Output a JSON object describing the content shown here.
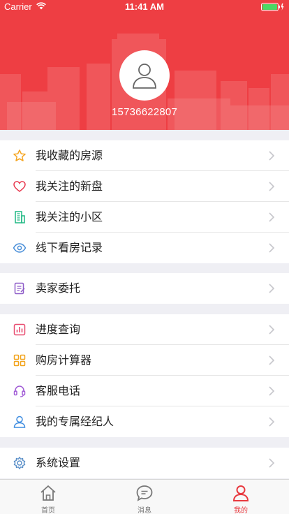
{
  "status_bar": {
    "carrier": "Carrier",
    "time": "11:41 AM"
  },
  "profile": {
    "phone": "15736622807"
  },
  "colors": {
    "brand": "#ee3e43",
    "accent": "#e8393f"
  },
  "menu_groups": [
    [
      {
        "label": "我收藏的房源",
        "icon": "star-icon"
      },
      {
        "label": "我关注的新盘",
        "icon": "heart-icon"
      },
      {
        "label": "我关注的小区",
        "icon": "building-icon"
      },
      {
        "label": "线下看房记录",
        "icon": "eye-icon"
      }
    ],
    [
      {
        "label": "卖家委托",
        "icon": "document-icon"
      }
    ],
    [
      {
        "label": "进度查询",
        "icon": "bar-chart-icon"
      },
      {
        "label": "购房计算器",
        "icon": "calculator-icon"
      },
      {
        "label": "客服电话",
        "icon": "headset-icon"
      },
      {
        "label": "我的专属经纪人",
        "icon": "agent-icon"
      }
    ],
    [
      {
        "label": "系统设置",
        "icon": "gear-icon"
      }
    ]
  ],
  "tabbar": [
    {
      "label": "首页",
      "icon": "home-icon",
      "active": false
    },
    {
      "label": "消息",
      "icon": "message-icon",
      "active": false
    },
    {
      "label": "我的",
      "icon": "person-icon",
      "active": true
    }
  ]
}
